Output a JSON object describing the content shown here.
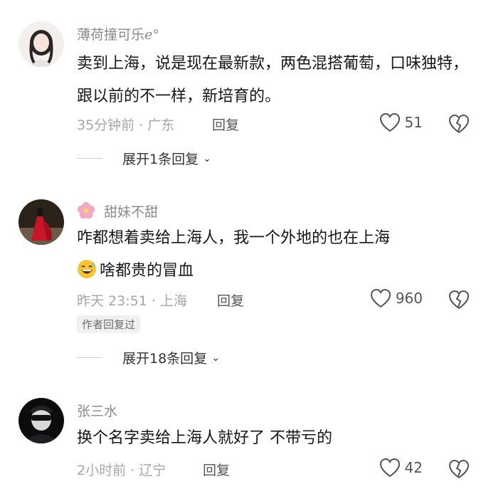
{
  "comments": [
    {
      "username": "薄荷撞可乐ℯ°",
      "text": "卖到上海，说是现在最新款，两色混搭葡萄，口味独特，跟以前的不一样，新培育的。",
      "meta": "35分钟前 · 广东",
      "reply_label": "回复",
      "likes": "51",
      "expand_label": "展开1条回复"
    },
    {
      "username": "甜妹不甜",
      "text_line1": "咋都想着卖给上海人，我一个外地的也在上海",
      "text_line2": "啥都贵的冒血",
      "meta": "昨天 23:51 · 上海",
      "reply_label": "回复",
      "likes": "960",
      "author_badge": "作者回复过",
      "expand_label": "展开18条回复"
    },
    {
      "username": "张三水",
      "text": "换个名字卖给上海人就好了 不带亏的",
      "meta": "2小时前 · 辽宁",
      "reply_label": "回复",
      "likes": "42"
    }
  ],
  "colors": {
    "meta": "#a6a6a6",
    "name": "#8a8a8a",
    "text": "#161616"
  }
}
